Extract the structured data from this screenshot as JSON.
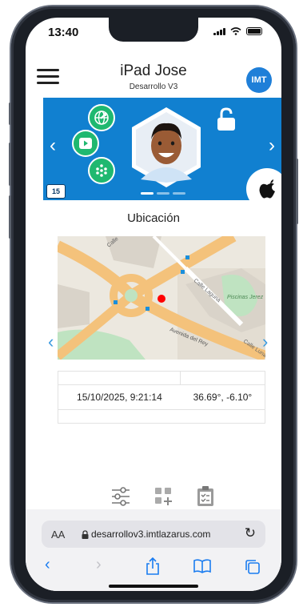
{
  "status_bar": {
    "time": "13:40"
  },
  "header": {
    "device_name": "iPad Jose",
    "subtitle": "Desarrollo V3",
    "user_initials": "IMT"
  },
  "banner": {
    "prev_icon": "chevron-left-icon",
    "next_icon": "chevron-right-icon",
    "calendar_day": "15",
    "os_icon": "apple-logo-icon",
    "background_color": "#1180d0"
  },
  "location": {
    "title": "Ubicación",
    "map": {
      "street_labels": [
        "Calle",
        "Calle Laguna",
        "Piscinas Jerez",
        "Avenida del Rey",
        "Calle Luna"
      ],
      "marker_color": "#ff0000"
    },
    "table": {
      "rows": [
        {
          "date": "15/10/2025, 9:21:14",
          "coords": "36.69°, -6.10°"
        }
      ]
    }
  },
  "toolbar": {
    "icons": [
      "sliders-icon",
      "add-widget-icon",
      "clipboard-check-icon"
    ]
  },
  "browser": {
    "aa_label": "AA",
    "url": "desarrollov3.imtlazarus.com",
    "reload_icon": "↻"
  }
}
